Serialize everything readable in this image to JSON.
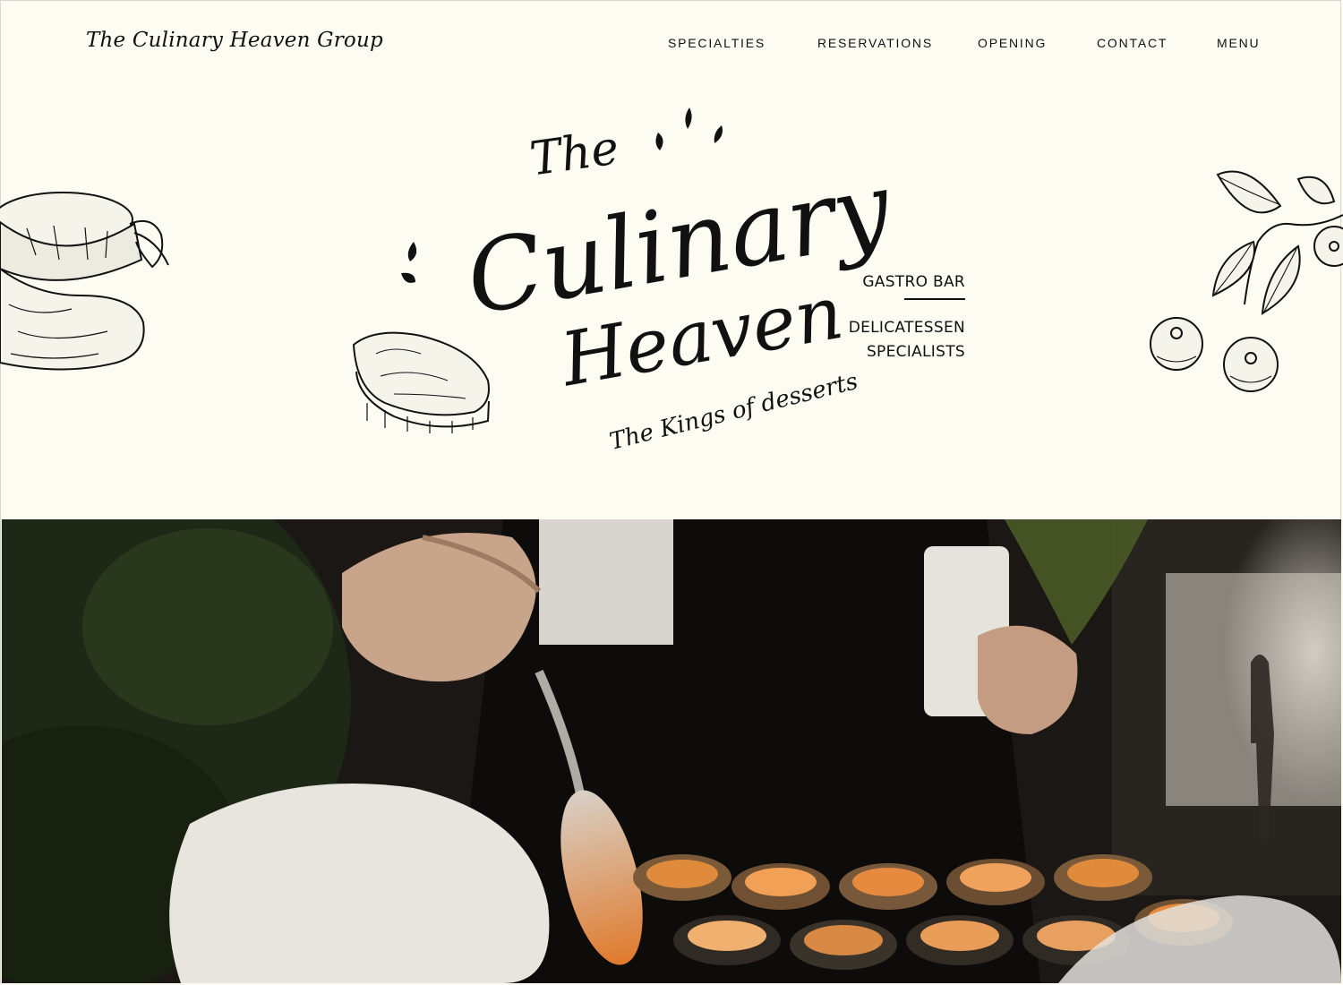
{
  "header": {
    "brand": "The Culinary Heaven Group",
    "nav": [
      {
        "label": "SPECIALTIES"
      },
      {
        "label": "RESERVATIONS"
      },
      {
        "label": "OPENING"
      },
      {
        "label": "CONTACT"
      },
      {
        "label": "MENU"
      }
    ]
  },
  "hero": {
    "logo": {
      "line1": "The",
      "line2": "Culinary",
      "line3": "Heaven",
      "tagline": "The Kings of desserts"
    },
    "side_tags": {
      "tag1": "GASTRO BAR",
      "tag2_line1": "DELICATESSEN",
      "tag2_line2": "SPECIALISTS"
    },
    "illustrations": [
      "jam-jar-icon",
      "bread-slice-icon",
      "blueberry-branch-icon"
    ]
  },
  "photo": {
    "subject": "chef-plating-oysters-photo"
  },
  "colors": {
    "background": "#fcfcf3",
    "ink": "#111111",
    "sauce": "#e07a2c"
  }
}
